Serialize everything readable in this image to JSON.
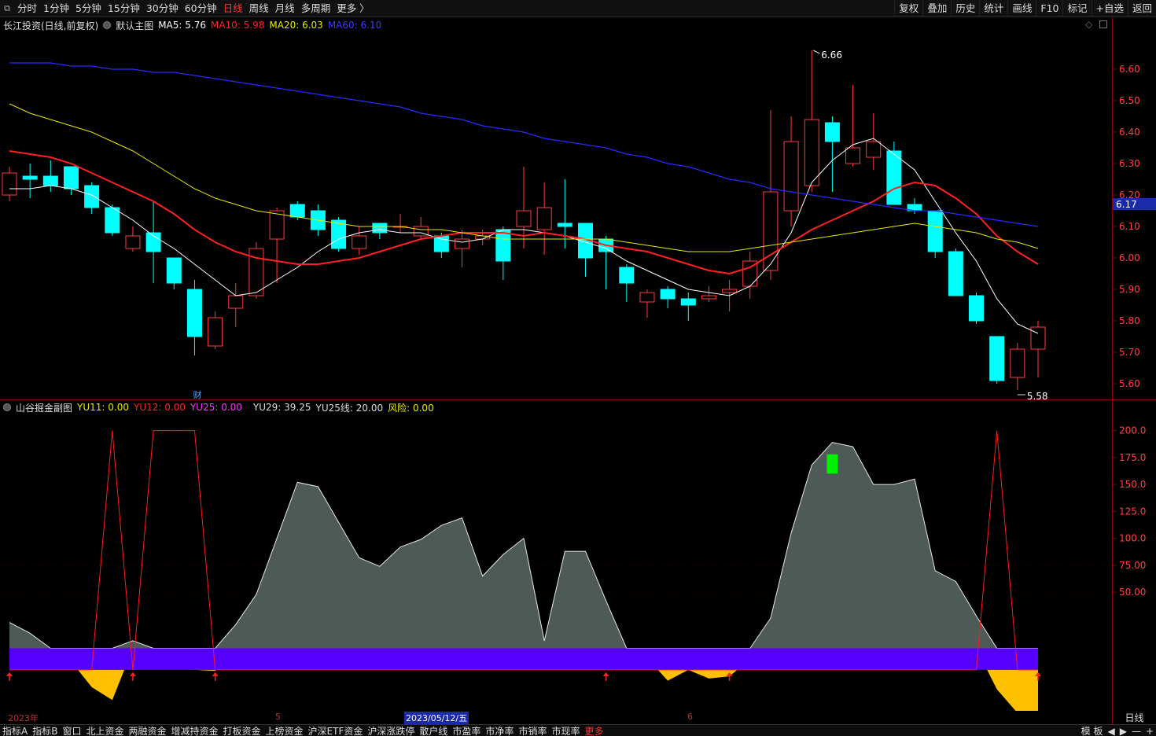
{
  "topbar": {
    "periods": [
      "分时",
      "1分钟",
      "5分钟",
      "15分钟",
      "30分钟",
      "60分钟",
      "日线",
      "周线",
      "月线",
      "多周期",
      "更多 〉"
    ],
    "active_period": "日线",
    "right_buttons": [
      "复权",
      "叠加",
      "历史",
      "统计",
      "画线",
      "F10",
      "标记",
      "+自选",
      "返回"
    ]
  },
  "main_legend": {
    "stock": "长江投资(日线,前复权)",
    "template": "默认主图",
    "ma5": "MA5: 5.76",
    "ma10": "MA10: 5.98",
    "ma20": "MA20: 6.03",
    "ma60": "MA60: 6.10"
  },
  "sub_legend": {
    "name": "山谷掘金副图",
    "yu11": "YU11: 0.00",
    "yu12": "YU12: 0.00",
    "yu25": "YU25: 0.00",
    "yu29": "YU29: 39.25",
    "yu25line": "YU25线: 20.00",
    "risk": "风险: 0.00"
  },
  "colors": {
    "up": "#ff3c3c",
    "down": "#00ffff",
    "ma5": "#ffffff",
    "ma10": "#ff2020",
    "ma20": "#e8e800",
    "ma60": "#2a2aff",
    "area": "#4d5a56",
    "band": "#5500ff",
    "valley": "#ffc000"
  },
  "price_axis": {
    "ticks": [
      "6.60",
      "6.50",
      "6.40",
      "6.30",
      "6.20",
      "6.10",
      "6.00",
      "5.90",
      "5.80",
      "5.70",
      "5.60"
    ],
    "current": "6.17"
  },
  "sub_axis": {
    "ticks": [
      "200.0",
      "175.0",
      "150.0",
      "125.0",
      "100.0",
      "75.00",
      "50.00"
    ]
  },
  "annotations": {
    "high": "6.66",
    "low": "5.58",
    "finance_marker": "财"
  },
  "date_axis": {
    "labels": [
      "2023年",
      "5",
      "2023/05/12/五",
      "6"
    ],
    "period_button": "日线"
  },
  "bottombar": {
    "items": [
      "指标A",
      "指标B",
      "窗口",
      "北上资金",
      "两融资金",
      "增减持资金",
      "打板资金",
      "上榜资金",
      "沪深ETF资金",
      "沪深涨跌停",
      "散户线",
      "市盈率",
      "市净率",
      "市销率",
      "市现率",
      "更多"
    ],
    "tail": [
      "模 板",
      "◀",
      "▶",
      "—",
      "+"
    ]
  },
  "chart_data": [
    {
      "type": "candlestick",
      "title": "长江投资(日线,前复权)",
      "ylim": [
        5.55,
        6.72
      ],
      "candles": [
        {
          "o": 6.2,
          "c": 6.27,
          "h": 6.29,
          "l": 6.18
        },
        {
          "o": 6.26,
          "c": 6.25,
          "h": 6.3,
          "l": 6.19
        },
        {
          "o": 6.26,
          "c": 6.23,
          "h": 6.31,
          "l": 6.21
        },
        {
          "o": 6.29,
          "c": 6.22,
          "h": 6.29,
          "l": 6.2
        },
        {
          "o": 6.23,
          "c": 6.16,
          "h": 6.24,
          "l": 6.14
        },
        {
          "o": 6.16,
          "c": 6.08,
          "h": 6.17,
          "l": 6.07
        },
        {
          "o": 6.03,
          "c": 6.07,
          "h": 6.1,
          "l": 6.02
        },
        {
          "o": 6.08,
          "c": 6.02,
          "h": 6.18,
          "l": 5.92
        },
        {
          "o": 6.0,
          "c": 5.92,
          "h": 6.0,
          "l": 5.9
        },
        {
          "o": 5.9,
          "c": 5.75,
          "h": 5.93,
          "l": 5.69
        },
        {
          "o": 5.72,
          "c": 5.81,
          "h": 5.83,
          "l": 5.71
        },
        {
          "o": 5.84,
          "c": 5.88,
          "h": 5.92,
          "l": 5.78
        },
        {
          "o": 5.88,
          "c": 6.03,
          "h": 6.05,
          "l": 5.87
        },
        {
          "o": 6.06,
          "c": 6.15,
          "h": 6.16,
          "l": 5.92
        },
        {
          "o": 6.17,
          "c": 6.13,
          "h": 6.18,
          "l": 6.12
        },
        {
          "o": 6.15,
          "c": 6.09,
          "h": 6.17,
          "l": 6.07
        },
        {
          "o": 6.12,
          "c": 6.03,
          "h": 6.13,
          "l": 6.02
        },
        {
          "o": 6.03,
          "c": 6.07,
          "h": 6.1,
          "l": 6.01
        },
        {
          "o": 6.11,
          "c": 6.08,
          "h": 6.11,
          "l": 6.06
        },
        {
          "o": 6.1,
          "c": 6.1,
          "h": 6.14,
          "l": 6.08
        },
        {
          "o": 6.07,
          "c": 6.1,
          "h": 6.13,
          "l": 6.06
        },
        {
          "o": 6.07,
          "c": 6.02,
          "h": 6.08,
          "l": 6.0
        },
        {
          "o": 6.03,
          "c": 6.06,
          "h": 6.09,
          "l": 5.97
        },
        {
          "o": 6.06,
          "c": 6.07,
          "h": 6.09,
          "l": 6.04
        },
        {
          "o": 6.09,
          "c": 5.99,
          "h": 6.1,
          "l": 5.93
        },
        {
          "o": 6.1,
          "c": 6.15,
          "h": 6.29,
          "l": 6.03
        },
        {
          "o": 6.09,
          "c": 6.16,
          "h": 6.24,
          "l": 6.01
        },
        {
          "o": 6.11,
          "c": 6.1,
          "h": 6.25,
          "l": 6.03
        },
        {
          "o": 6.11,
          "c": 6.0,
          "h": 6.11,
          "l": 5.94
        },
        {
          "o": 6.06,
          "c": 6.02,
          "h": 6.07,
          "l": 5.9
        },
        {
          "o": 5.97,
          "c": 5.92,
          "h": 5.98,
          "l": 5.86
        },
        {
          "o": 5.86,
          "c": 5.89,
          "h": 5.9,
          "l": 5.81
        },
        {
          "o": 5.9,
          "c": 5.87,
          "h": 5.91,
          "l": 5.84
        },
        {
          "o": 5.87,
          "c": 5.85,
          "h": 5.89,
          "l": 5.8
        },
        {
          "o": 5.87,
          "c": 5.88,
          "h": 5.91,
          "l": 5.86
        },
        {
          "o": 5.89,
          "c": 5.9,
          "h": 5.93,
          "l": 5.83
        },
        {
          "o": 5.91,
          "c": 5.99,
          "h": 6.02,
          "l": 5.87
        },
        {
          "o": 5.96,
          "c": 6.21,
          "h": 6.47,
          "l": 5.93
        },
        {
          "o": 6.15,
          "c": 6.37,
          "h": 6.45,
          "l": 6.1
        },
        {
          "o": 6.23,
          "c": 6.44,
          "h": 6.66,
          "l": 6.21
        },
        {
          "o": 6.43,
          "c": 6.37,
          "h": 6.45,
          "l": 6.21
        },
        {
          "o": 6.3,
          "c": 6.35,
          "h": 6.55,
          "l": 6.29
        },
        {
          "o": 6.32,
          "c": 6.37,
          "h": 6.46,
          "l": 6.28
        },
        {
          "o": 6.34,
          "c": 6.17,
          "h": 6.37,
          "l": 6.17
        },
        {
          "o": 6.17,
          "c": 6.15,
          "h": 6.19,
          "l": 6.14
        },
        {
          "o": 6.15,
          "c": 6.02,
          "h": 6.15,
          "l": 6.0
        },
        {
          "o": 6.02,
          "c": 5.88,
          "h": 6.03,
          "l": 5.88
        },
        {
          "o": 5.88,
          "c": 5.8,
          "h": 5.89,
          "l": 5.79
        },
        {
          "o": 5.75,
          "c": 5.61,
          "h": 5.75,
          "l": 5.6
        },
        {
          "o": 5.62,
          "c": 5.71,
          "h": 5.73,
          "l": 5.58
        },
        {
          "o": 5.71,
          "c": 5.78,
          "h": 5.8,
          "l": 5.62
        }
      ],
      "series": [
        {
          "name": "MA5",
          "values": [
            6.22,
            6.22,
            6.23,
            6.22,
            6.2,
            6.16,
            6.12,
            6.07,
            6.03,
            5.98,
            5.93,
            5.88,
            5.89,
            5.93,
            5.97,
            6.02,
            6.06,
            6.08,
            6.09,
            6.08,
            6.08,
            6.06,
            6.05,
            6.06,
            6.09,
            6.09,
            6.08,
            6.07,
            6.05,
            6.03,
            5.99,
            5.96,
            5.93,
            5.9,
            5.89,
            5.88,
            5.91,
            5.98,
            6.08,
            6.24,
            6.31,
            6.36,
            6.38,
            6.33,
            6.28,
            6.18,
            6.08,
            5.99,
            5.87,
            5.79,
            5.76
          ]
        },
        {
          "name": "MA10",
          "values": [
            6.34,
            6.33,
            6.32,
            6.3,
            6.27,
            6.24,
            6.21,
            6.18,
            6.14,
            6.09,
            6.05,
            6.02,
            6.0,
            5.99,
            5.98,
            5.98,
            5.99,
            6.0,
            6.02,
            6.04,
            6.06,
            6.07,
            6.08,
            6.08,
            6.08,
            6.07,
            6.08,
            6.07,
            6.06,
            6.04,
            6.03,
            6.02,
            6.0,
            5.98,
            5.96,
            5.95,
            5.97,
            6.01,
            6.05,
            6.09,
            6.12,
            6.15,
            6.18,
            6.22,
            6.24,
            6.23,
            6.19,
            6.14,
            6.07,
            6.02,
            5.98
          ]
        },
        {
          "name": "MA20",
          "values": [
            6.49,
            6.46,
            6.44,
            6.42,
            6.4,
            6.37,
            6.34,
            6.3,
            6.26,
            6.22,
            6.19,
            6.17,
            6.15,
            6.14,
            6.13,
            6.12,
            6.11,
            6.1,
            6.1,
            6.1,
            6.09,
            6.09,
            6.08,
            6.07,
            6.06,
            6.06,
            6.06,
            6.06,
            6.06,
            6.06,
            6.05,
            6.04,
            6.03,
            6.02,
            6.02,
            6.02,
            6.03,
            6.04,
            6.05,
            6.06,
            6.07,
            6.08,
            6.09,
            6.1,
            6.11,
            6.1,
            6.09,
            6.08,
            6.06,
            6.05,
            6.03
          ]
        },
        {
          "name": "MA60",
          "values": [
            6.62,
            6.62,
            6.62,
            6.61,
            6.61,
            6.6,
            6.6,
            6.59,
            6.59,
            6.58,
            6.57,
            6.56,
            6.55,
            6.54,
            6.53,
            6.52,
            6.51,
            6.5,
            6.49,
            6.48,
            6.46,
            6.45,
            6.44,
            6.42,
            6.41,
            6.4,
            6.38,
            6.37,
            6.36,
            6.35,
            6.33,
            6.32,
            6.3,
            6.29,
            6.27,
            6.25,
            6.24,
            6.22,
            6.21,
            6.2,
            6.19,
            6.18,
            6.17,
            6.16,
            6.15,
            6.15,
            6.14,
            6.13,
            6.12,
            6.11,
            6.1
          ]
        }
      ]
    },
    {
      "type": "area",
      "title": "山谷掘金副图",
      "ylim": [
        -60,
        215
      ],
      "area_values": [
        22,
        12,
        -10,
        -14,
        -38,
        -50,
        5,
        -2,
        -12,
        -22,
        -23,
        20,
        48,
        100,
        152,
        148,
        115,
        82,
        74,
        92,
        99,
        112,
        119,
        65,
        85,
        100,
        5,
        88,
        88,
        42,
        -8,
        -11,
        -32,
        -22,
        -30,
        -28,
        -12,
        26,
        105,
        168,
        189,
        185,
        150,
        150,
        155,
        70,
        60,
        28,
        -40,
        -62,
        -60
      ],
      "red_line_values": [
        -22,
        -22,
        -22,
        -22,
        -22,
        200,
        -22,
        200,
        200,
        200,
        -22,
        -22,
        -22,
        -22,
        -22,
        -22,
        -22,
        -22,
        -22,
        -22,
        -22,
        -22,
        -22,
        -22,
        -22,
        -22,
        -22,
        -22,
        -22,
        -22,
        -22,
        -22,
        -22,
        -22,
        -22,
        -22,
        -22,
        -22,
        -22,
        -22,
        -22,
        -22,
        -22,
        -22,
        -22,
        -22,
        -22,
        -22,
        200,
        -22,
        -22
      ],
      "band": [
        -22,
        -2
      ],
      "green_marker_index": 40,
      "arrow_indices": [
        0,
        6,
        10,
        29,
        35,
        50
      ]
    }
  ]
}
